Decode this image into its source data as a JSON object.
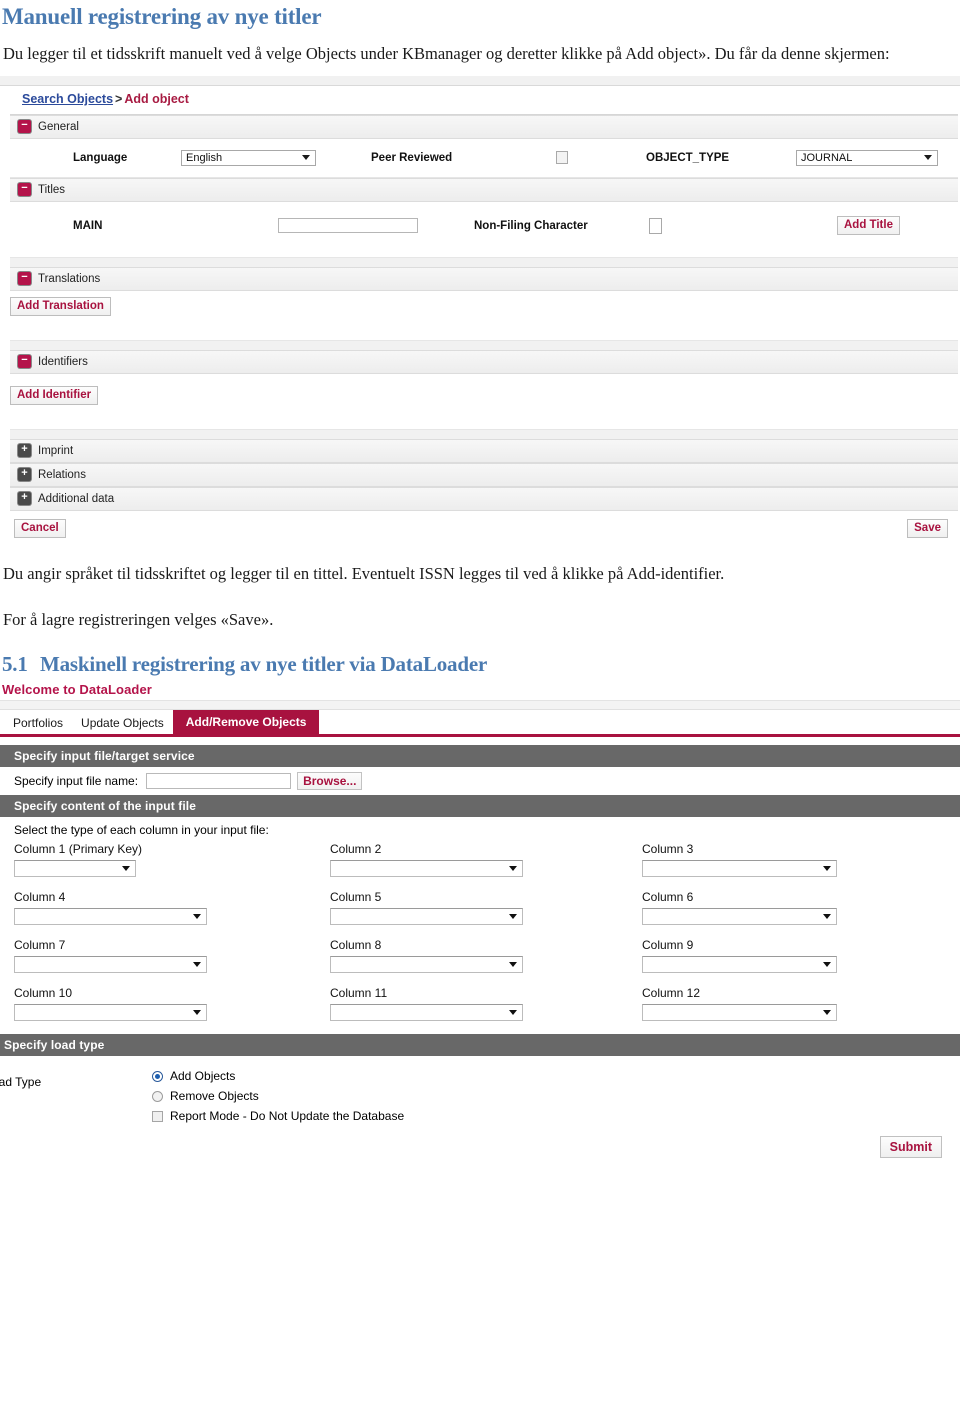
{
  "document": {
    "heading1": "Manuell registrering av nye titler",
    "paragraph1": "Du legger til et tidsskrift manuelt ved å velge Objects under KBmanager og deretter klikke på Add object». Du får da denne skjermen:",
    "paragraph2": "Du angir språket til tidsskriftet og legger til en tittel. Eventuelt ISSN legges til ved å klikke på Add-identifier.",
    "paragraph3": "For å lagre registreringen velges «Save».",
    "heading2_number": "5.1",
    "heading2_text": "Maskinell registrering av nye titler via DataLoader"
  },
  "colors": {
    "heading_blue": "#4a7ab0",
    "accent_crimson": "#a8123f",
    "toggle_minus": "#b4134a",
    "toggle_plus": "#4a4a4a",
    "bar_gray": "#686868",
    "link_blue": "#2b4a9b"
  },
  "add_object_screen": {
    "breadcrumb": {
      "link": "Search Objects",
      "separator": ">",
      "current": "Add object"
    },
    "sections": {
      "general": {
        "label": "General",
        "toggle": "minus-icon",
        "fields": {
          "language_label": "Language",
          "language_value": "English",
          "peer_reviewed_label": "Peer Reviewed",
          "object_type_label": "OBJECT_TYPE",
          "object_type_value": "JOURNAL"
        }
      },
      "titles": {
        "label": "Titles",
        "toggle": "minus-icon",
        "main_label": "MAIN",
        "main_value": "",
        "non_filing_label": "Non-Filing Character",
        "non_filing_value": "",
        "add_title_button": "Add Title"
      },
      "translations": {
        "label": "Translations",
        "toggle": "minus-icon",
        "add_button": "Add Translation"
      },
      "identifiers": {
        "label": "Identifiers",
        "toggle": "minus-icon",
        "add_button": "Add Identifier"
      },
      "imprint": {
        "label": "Imprint",
        "toggle": "plus-icon"
      },
      "relations": {
        "label": "Relations",
        "toggle": "plus-icon"
      },
      "additional_data": {
        "label": "Additional data",
        "toggle": "plus-icon"
      }
    },
    "footer": {
      "cancel_button": "Cancel",
      "save_button": "Save"
    }
  },
  "dataloader_screen": {
    "welcome_title": "Welcome to DataLoader",
    "tabs": [
      {
        "label": "Portfolios",
        "active": false
      },
      {
        "label": "Update Objects",
        "active": false
      },
      {
        "label": "Add/Remove Objects",
        "active": true
      }
    ],
    "input_section": {
      "bar_label": "Specify input file/target service",
      "file_name_label": "Specify input file name:",
      "file_name_value": "",
      "browse_button": "Browse..."
    },
    "content_section": {
      "bar_label": "Specify content of the input file",
      "hint": "Select the type of each column in your input file:",
      "columns": [
        {
          "label": "Column 1 (Primary Key)",
          "value": ""
        },
        {
          "label": "Column 2",
          "value": ""
        },
        {
          "label": "Column 3",
          "value": ""
        },
        {
          "label": "Column 4",
          "value": ""
        },
        {
          "label": "Column 5",
          "value": ""
        },
        {
          "label": "Column 6",
          "value": ""
        },
        {
          "label": "Column 7",
          "value": ""
        },
        {
          "label": "Column 8",
          "value": ""
        },
        {
          "label": "Column 9",
          "value": ""
        },
        {
          "label": "Column 10",
          "value": ""
        },
        {
          "label": "Column 11",
          "value": ""
        },
        {
          "label": "Column 12",
          "value": ""
        }
      ]
    },
    "load_type_section": {
      "bar_label": "Specify load type",
      "label": "oad Type",
      "options": [
        {
          "label": "Add Objects",
          "type": "radio",
          "selected": true
        },
        {
          "label": "Remove Objects",
          "type": "radio",
          "selected": false
        },
        {
          "label": "Report Mode - Do Not Update the Database",
          "type": "checkbox",
          "selected": false
        }
      ],
      "submit_button": "Submit"
    }
  }
}
